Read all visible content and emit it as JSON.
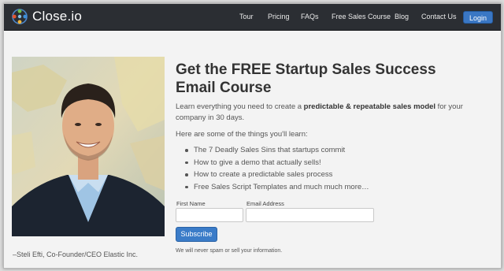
{
  "brand": {
    "name": "Close.io"
  },
  "nav": {
    "links": [
      "Tour",
      "Pricing",
      "FAQs",
      "Free Sales Course",
      "Blog",
      "Contact Us"
    ],
    "login_label": "Login"
  },
  "hero": {
    "headline": "Get the FREE Startup Sales Success Email Course",
    "lead_prefix": "Learn everything you need to create a ",
    "lead_bold": "predictable & repeatable sales model",
    "lead_suffix": " for your company in 30 days.",
    "sub_heading": "Here are some of the things you'll learn:",
    "bullets": [
      "The 7 Deadly Sales Sins that startups commit",
      "How to give a demo that actually sells!",
      "How to create a predictable sales process",
      "Free Sales Script Templates and much much more…"
    ],
    "photo_caption": "–Steli Efti, Co-Founder/CEO Elastic Inc."
  },
  "form": {
    "first_name_label": "First Name",
    "first_name_value": "",
    "email_label": "Email Address",
    "email_value": "",
    "subscribe_label": "Subscribe",
    "disclaimer": "We will never spam or sell your information."
  },
  "colors": {
    "nav_bg": "#2b2e33",
    "accent": "#3b7cc8",
    "page_bg": "#f3f3f3"
  }
}
